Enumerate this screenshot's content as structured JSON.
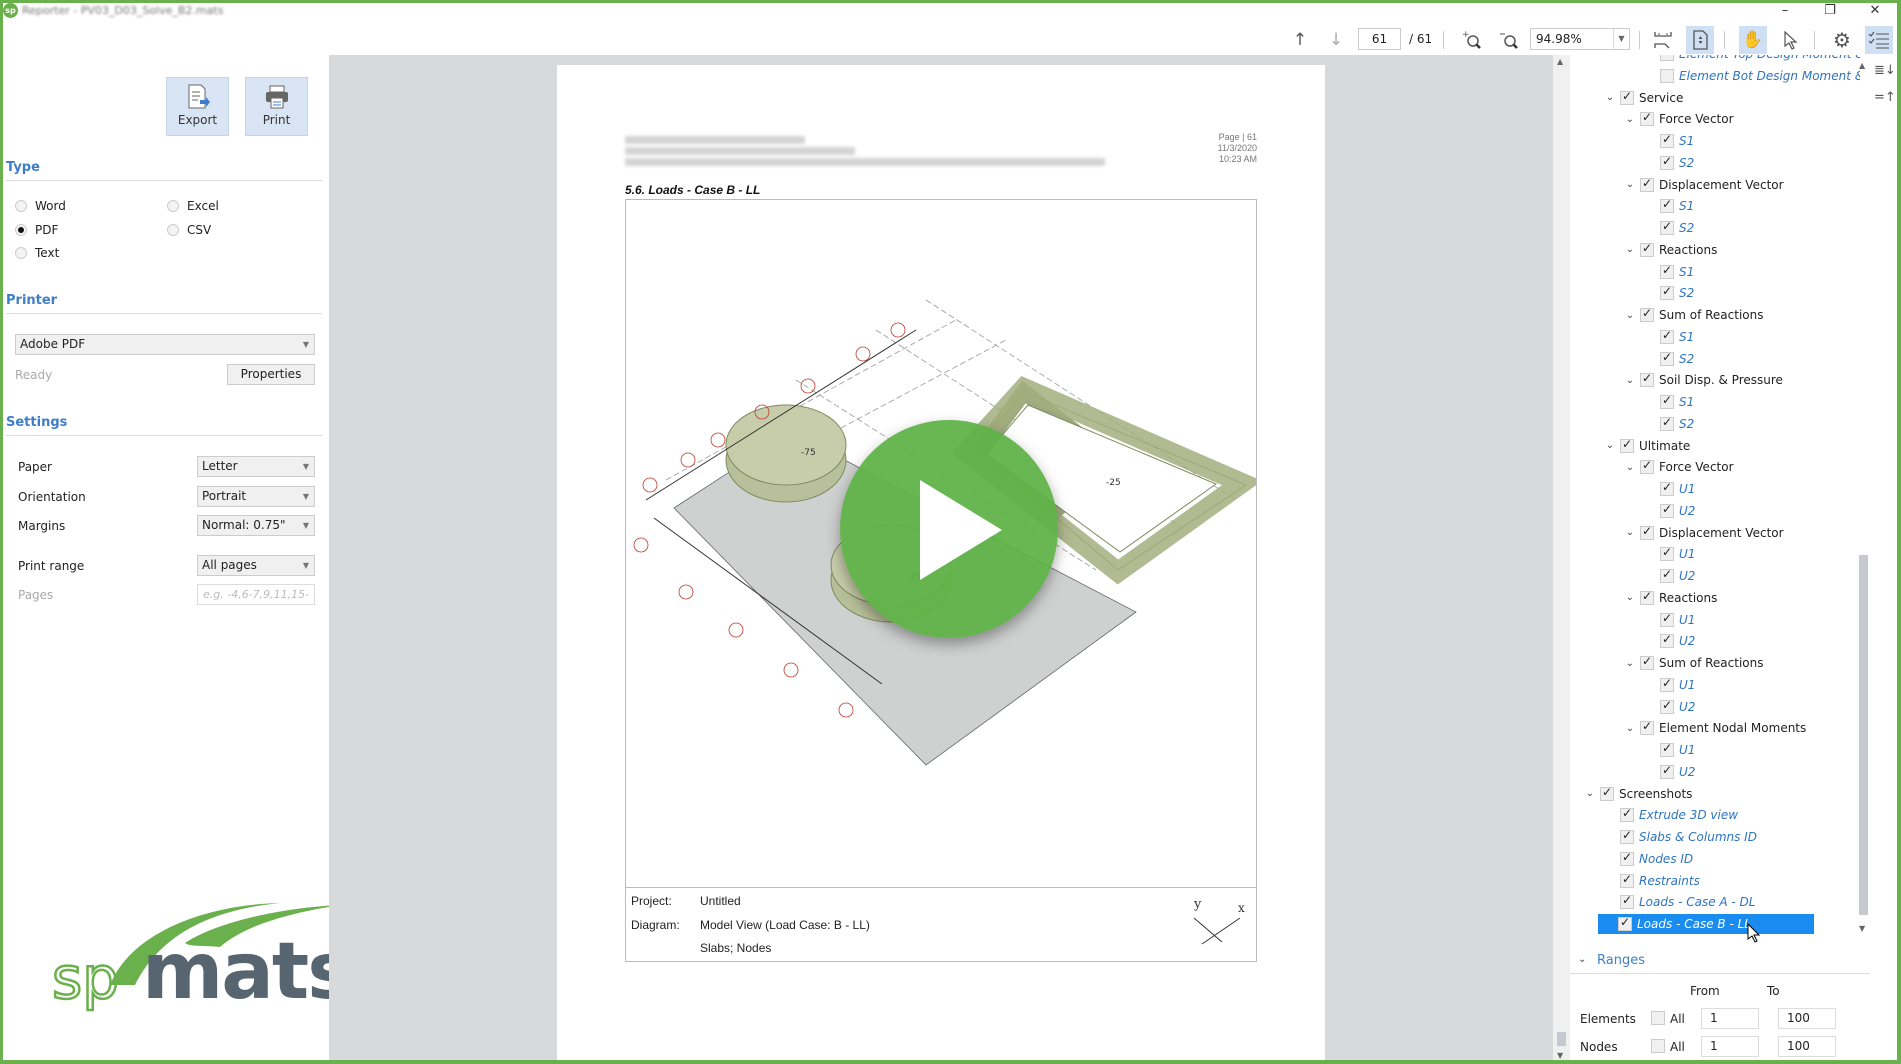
{
  "window": {
    "title": "Reporter - PV03_D03_Solve_B2.mats",
    "app_logo": "sp",
    "controls": {
      "minimize": "–",
      "restore": "❐",
      "close": "✕"
    }
  },
  "toolbar": {
    "prev_page_icon": "arrow-up-icon",
    "next_page_icon": "arrow-down-icon",
    "current_page": "61",
    "total_pages": "/ 61",
    "zoom_in_icon": "zoom-in-icon",
    "zoom_out_icon": "zoom-out-icon",
    "zoom_level": "94.98%",
    "fit_width_icon": "fit-width-icon",
    "fit_page_icon": "fit-page-icon",
    "pan_icon": "hand-icon",
    "select_icon": "pointer-icon",
    "settings_icon": "gear-icon",
    "contents_icon": "checklist-icon"
  },
  "left_panel": {
    "export_label": "Export",
    "print_label": "Print",
    "type": {
      "heading": "Type",
      "options": [
        {
          "label": "Word",
          "selected": false
        },
        {
          "label": "PDF",
          "selected": true
        },
        {
          "label": "Text",
          "selected": false
        },
        {
          "label": "Excel",
          "selected": false
        },
        {
          "label": "CSV",
          "selected": false
        }
      ]
    },
    "printer": {
      "heading": "Printer",
      "selected": "Adobe PDF",
      "status": "Ready",
      "properties_label": "Properties"
    },
    "settings": {
      "heading": "Settings",
      "paper_label": "Paper",
      "paper_value": "Letter",
      "orientation_label": "Orientation",
      "orientation_value": "Portrait",
      "margins_label": "Margins",
      "margins_value": "Normal: 0.75\"",
      "print_range_label": "Print range",
      "print_range_value": "All pages",
      "pages_label": "Pages",
      "pages_placeholder": "e.g. -4,6-7,9,11,15-"
    },
    "brand": {
      "prefix": "sp",
      "name": "mats"
    }
  },
  "document": {
    "page_label": "Page | 61",
    "date": "11/3/2020",
    "time": "10:23 AM",
    "heading": "5.6. Loads - Case B - LL",
    "figure": {
      "project_label": "Project:",
      "project_value": "Untitled",
      "diagram_label": "Diagram:",
      "diagram_value": "Model View (Load Case: B - LL)",
      "diagram_value2": "Slabs; Nodes",
      "axis_y": "y",
      "axis_x": "x",
      "load_labels": [
        "-75",
        "-75",
        "-25"
      ]
    }
  },
  "video": {
    "play_icon": "play-icon"
  },
  "tree": {
    "items": [
      {
        "level": 2,
        "label": "Element Top Design Moment & Reinf.",
        "checked": false,
        "leaf": true,
        "clipped": true
      },
      {
        "level": 2,
        "label": "Element Bot Design Moment & Reinf.",
        "checked": false,
        "leaf": true
      },
      {
        "level": 0,
        "label": "Service",
        "checked": true,
        "expandable": true
      },
      {
        "level": 1,
        "label": "Force Vector",
        "checked": true,
        "expandable": true
      },
      {
        "level": 2,
        "label": "S1",
        "checked": true,
        "leaf": true
      },
      {
        "level": 2,
        "label": "S2",
        "checked": true,
        "leaf": true
      },
      {
        "level": 1,
        "label": "Displacement Vector",
        "checked": true,
        "expandable": true
      },
      {
        "level": 2,
        "label": "S1",
        "checked": true,
        "leaf": true
      },
      {
        "level": 2,
        "label": "S2",
        "checked": true,
        "leaf": true
      },
      {
        "level": 1,
        "label": "Reactions",
        "checked": true,
        "expandable": true
      },
      {
        "level": 2,
        "label": "S1",
        "checked": true,
        "leaf": true
      },
      {
        "level": 2,
        "label": "S2",
        "checked": true,
        "leaf": true
      },
      {
        "level": 1,
        "label": "Sum of Reactions",
        "checked": true,
        "expandable": true
      },
      {
        "level": 2,
        "label": "S1",
        "checked": true,
        "leaf": true
      },
      {
        "level": 2,
        "label": "S2",
        "checked": true,
        "leaf": true
      },
      {
        "level": 1,
        "label": "Soil Disp. & Pressure",
        "checked": true,
        "expandable": true
      },
      {
        "level": 2,
        "label": "S1",
        "checked": true,
        "leaf": true
      },
      {
        "level": 2,
        "label": "S2",
        "checked": true,
        "leaf": true
      },
      {
        "level": 0,
        "label": "Ultimate",
        "checked": true,
        "expandable": true
      },
      {
        "level": 1,
        "label": "Force Vector",
        "checked": true,
        "expandable": true
      },
      {
        "level": 2,
        "label": "U1",
        "checked": true,
        "leaf": true
      },
      {
        "level": 2,
        "label": "U2",
        "checked": true,
        "leaf": true
      },
      {
        "level": 1,
        "label": "Displacement Vector",
        "checked": true,
        "expandable": true
      },
      {
        "level": 2,
        "label": "U1",
        "checked": true,
        "leaf": true
      },
      {
        "level": 2,
        "label": "U2",
        "checked": true,
        "leaf": true
      },
      {
        "level": 1,
        "label": "Reactions",
        "checked": true,
        "expandable": true
      },
      {
        "level": 2,
        "label": "U1",
        "checked": true,
        "leaf": true
      },
      {
        "level": 2,
        "label": "U2",
        "checked": true,
        "leaf": true
      },
      {
        "level": 1,
        "label": "Sum of Reactions",
        "checked": true,
        "expandable": true
      },
      {
        "level": 2,
        "label": "U1",
        "checked": true,
        "leaf": true
      },
      {
        "level": 2,
        "label": "U2",
        "checked": true,
        "leaf": true
      },
      {
        "level": 1,
        "label": "Element Nodal Moments",
        "checked": true,
        "expandable": true
      },
      {
        "level": 2,
        "label": "U1",
        "checked": true,
        "leaf": true
      },
      {
        "level": 2,
        "label": "U2",
        "checked": true,
        "leaf": true
      },
      {
        "level": -1,
        "label": "Screenshots",
        "checked": true,
        "expandable": true
      },
      {
        "level": 0,
        "label": "Extrude 3D view",
        "checked": true,
        "leaf": true
      },
      {
        "level": 0,
        "label": "Slabs & Columns ID",
        "checked": true,
        "leaf": true
      },
      {
        "level": 0,
        "label": "Nodes ID",
        "checked": true,
        "leaf": true
      },
      {
        "level": 0,
        "label": "Restraints",
        "checked": true,
        "leaf": true
      },
      {
        "level": 0,
        "label": "Loads - Case A - DL",
        "checked": true,
        "leaf": true
      },
      {
        "level": 0,
        "label": "Loads - Case B - LL",
        "checked": true,
        "leaf": true,
        "selected": true
      }
    ],
    "side_tools": {
      "expand_all": "≣↓",
      "collapse_all": "=↑"
    }
  },
  "ranges": {
    "heading": "Ranges",
    "from_label": "From",
    "to_label": "To",
    "rows": [
      {
        "label": "Elements",
        "all_label": "All",
        "all_checked": false,
        "from": "1",
        "to": "100"
      },
      {
        "label": "Nodes",
        "all_label": "All",
        "all_checked": false,
        "from": "1",
        "to": "100"
      }
    ]
  },
  "colors": {
    "frame_green": "#6ab04c",
    "accent_blue": "#3e7ec7",
    "selection_blue": "#1a8cf0",
    "brand_gray": "#56656f"
  }
}
